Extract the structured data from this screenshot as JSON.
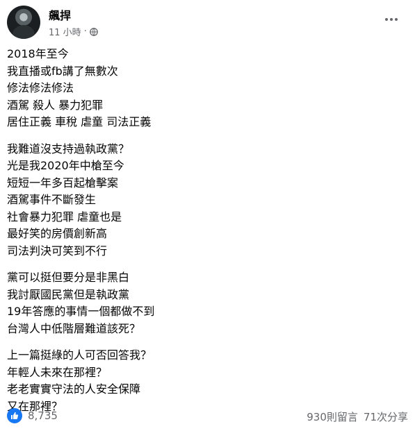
{
  "post": {
    "author": "飆捍",
    "time": "11 小時",
    "audience_icon": "globe-icon",
    "more_icon": "more-options-icon",
    "paragraphs": [
      [
        "2018年至今",
        "我直播或fb講了無數次",
        "修法修法修法",
        "酒駕 殺人 暴力犯罪",
        "居住正義 車稅 虐童 司法正義"
      ],
      [
        "我難道沒支持過執政黨？",
        "光是我2020年中槍至今",
        "短短一年多百起槍擊案",
        "酒駕事件不斷發生",
        "社會暴力犯罪 虐童也是",
        "最好笑的房價創新高",
        "司法判決可笑到不行"
      ],
      [
        "黨可以挺但要分是非黑白",
        "我討厭國民黨但是執政黨",
        "19年答應的事情一個都做不到",
        "台灣人中低階層難道該死？"
      ],
      [
        "上一篇挺綠的人可否回答我？",
        "年輕人未來在那裡？",
        "老老實實守法的人安全保障",
        "又在那裡？"
      ]
    ]
  },
  "footer": {
    "reaction_icon": "like-icon",
    "like_count": "8,735",
    "comments": "930則留言",
    "shares": "71次分享"
  },
  "colors": {
    "like_blue": "#1877f2",
    "secondary_text": "#65676b",
    "text": "#050505"
  }
}
